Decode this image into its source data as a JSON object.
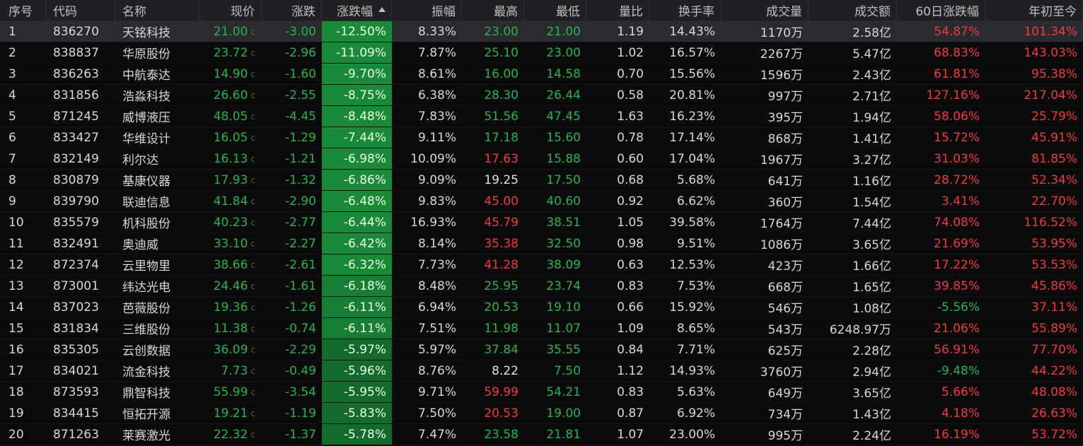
{
  "headers": {
    "seq": "序号",
    "code": "代码",
    "name": "名称",
    "price": "现价",
    "change": "涨跌",
    "pct": "涨跌幅",
    "amplitude": "振幅",
    "high": "最高",
    "low": "最低",
    "vol_ratio": "量比",
    "turnover": "换手率",
    "volume": "成交量",
    "amount": "成交额",
    "change_60d": "60日涨跌幅",
    "ytd": "年初至今"
  },
  "price_unit": "c",
  "colors": {
    "up": "#ef3b3b",
    "down": "#27b548",
    "pct_bg_strong": "#1b8a38",
    "pct_bg_mid": "#187e34",
    "pct_bg_weak": "#14692d"
  },
  "rows": [
    {
      "seq": "1",
      "code": "836270",
      "name": "天铭科技",
      "price": "21.00",
      "change": "-3.00",
      "pct": "-12.50%",
      "amplitude": "8.33%",
      "high": "23.00",
      "low": "21.00",
      "vol_ratio": "1.19",
      "turnover": "14.43%",
      "volume": "1170万",
      "amount": "2.58亿",
      "change_60d": "54.87%",
      "ytd": "101.34%",
      "high_color": "green",
      "low_color": "green",
      "d60_color": "red",
      "ytd_color": "red"
    },
    {
      "seq": "2",
      "code": "838837",
      "name": "华原股份",
      "price": "23.72",
      "change": "-2.96",
      "pct": "-11.09%",
      "amplitude": "7.87%",
      "high": "25.10",
      "low": "23.00",
      "vol_ratio": "1.02",
      "turnover": "16.57%",
      "volume": "2267万",
      "amount": "5.47亿",
      "change_60d": "68.83%",
      "ytd": "143.03%",
      "high_color": "green",
      "low_color": "green",
      "d60_color": "red",
      "ytd_color": "red"
    },
    {
      "seq": "3",
      "code": "836263",
      "name": "中航泰达",
      "price": "14.90",
      "change": "-1.60",
      "pct": "-9.70%",
      "amplitude": "8.61%",
      "high": "16.00",
      "low": "14.58",
      "vol_ratio": "0.70",
      "turnover": "15.56%",
      "volume": "1596万",
      "amount": "2.43亿",
      "change_60d": "61.81%",
      "ytd": "95.38%",
      "high_color": "green",
      "low_color": "green",
      "d60_color": "red",
      "ytd_color": "red"
    },
    {
      "seq": "4",
      "code": "831856",
      "name": "浩淼科技",
      "price": "26.60",
      "change": "-2.55",
      "pct": "-8.75%",
      "amplitude": "6.38%",
      "high": "28.30",
      "low": "26.44",
      "vol_ratio": "0.58",
      "turnover": "20.81%",
      "volume": "997万",
      "amount": "2.71亿",
      "change_60d": "127.16%",
      "ytd": "217.04%",
      "high_color": "green",
      "low_color": "green",
      "d60_color": "red",
      "ytd_color": "red"
    },
    {
      "seq": "5",
      "code": "871245",
      "name": "威博液压",
      "price": "48.05",
      "change": "-4.45",
      "pct": "-8.48%",
      "amplitude": "7.83%",
      "high": "51.56",
      "low": "47.45",
      "vol_ratio": "1.63",
      "turnover": "16.23%",
      "volume": "395万",
      "amount": "1.94亿",
      "change_60d": "58.06%",
      "ytd": "25.79%",
      "high_color": "green",
      "low_color": "green",
      "d60_color": "red",
      "ytd_color": "red"
    },
    {
      "seq": "6",
      "code": "833427",
      "name": "华维设计",
      "price": "16.05",
      "change": "-1.29",
      "pct": "-7.44%",
      "amplitude": "9.11%",
      "high": "17.18",
      "low": "15.60",
      "vol_ratio": "0.78",
      "turnover": "17.14%",
      "volume": "868万",
      "amount": "1.41亿",
      "change_60d": "15.72%",
      "ytd": "45.91%",
      "high_color": "green",
      "low_color": "green",
      "d60_color": "red",
      "ytd_color": "red"
    },
    {
      "seq": "7",
      "code": "832149",
      "name": "利尔达",
      "price": "16.13",
      "change": "-1.21",
      "pct": "-6.98%",
      "amplitude": "10.09%",
      "high": "17.63",
      "low": "15.88",
      "vol_ratio": "0.60",
      "turnover": "17.04%",
      "volume": "1967万",
      "amount": "3.27亿",
      "change_60d": "31.03%",
      "ytd": "81.85%",
      "high_color": "red",
      "low_color": "green",
      "d60_color": "red",
      "ytd_color": "red"
    },
    {
      "seq": "8",
      "code": "830879",
      "name": "基康仪器",
      "price": "17.93",
      "change": "-1.32",
      "pct": "-6.86%",
      "amplitude": "9.09%",
      "high": "19.25",
      "low": "17.50",
      "vol_ratio": "0.68",
      "turnover": "5.68%",
      "volume": "641万",
      "amount": "1.16亿",
      "change_60d": "28.72%",
      "ytd": "52.34%",
      "high_color": "white",
      "low_color": "green",
      "d60_color": "red",
      "ytd_color": "red"
    },
    {
      "seq": "9",
      "code": "839790",
      "name": "联迪信息",
      "price": "41.84",
      "change": "-2.90",
      "pct": "-6.48%",
      "amplitude": "9.83%",
      "high": "45.00",
      "low": "40.60",
      "vol_ratio": "0.92",
      "turnover": "6.62%",
      "volume": "360万",
      "amount": "1.54亿",
      "change_60d": "3.41%",
      "ytd": "22.70%",
      "high_color": "red",
      "low_color": "green",
      "d60_color": "red",
      "ytd_color": "red"
    },
    {
      "seq": "10",
      "code": "835579",
      "name": "机科股份",
      "price": "40.23",
      "change": "-2.77",
      "pct": "-6.44%",
      "amplitude": "16.93%",
      "high": "45.79",
      "low": "38.51",
      "vol_ratio": "1.05",
      "turnover": "39.58%",
      "volume": "1764万",
      "amount": "7.44亿",
      "change_60d": "74.08%",
      "ytd": "116.52%",
      "high_color": "red",
      "low_color": "green",
      "d60_color": "red",
      "ytd_color": "red"
    },
    {
      "seq": "11",
      "code": "832491",
      "name": "奥迪威",
      "price": "33.10",
      "change": "-2.27",
      "pct": "-6.42%",
      "amplitude": "8.14%",
      "high": "35.38",
      "low": "32.50",
      "vol_ratio": "0.98",
      "turnover": "9.51%",
      "volume": "1086万",
      "amount": "3.65亿",
      "change_60d": "21.69%",
      "ytd": "53.95%",
      "high_color": "red",
      "low_color": "green",
      "d60_color": "red",
      "ytd_color": "red"
    },
    {
      "seq": "12",
      "code": "872374",
      "name": "云里物里",
      "price": "38.66",
      "change": "-2.61",
      "pct": "-6.32%",
      "amplitude": "7.73%",
      "high": "41.28",
      "low": "38.09",
      "vol_ratio": "0.63",
      "turnover": "12.53%",
      "volume": "423万",
      "amount": "1.66亿",
      "change_60d": "17.22%",
      "ytd": "53.53%",
      "high_color": "red",
      "low_color": "green",
      "d60_color": "red",
      "ytd_color": "red"
    },
    {
      "seq": "13",
      "code": "873001",
      "name": "纬达光电",
      "price": "24.46",
      "change": "-1.61",
      "pct": "-6.18%",
      "amplitude": "8.48%",
      "high": "25.95",
      "low": "23.74",
      "vol_ratio": "0.83",
      "turnover": "7.53%",
      "volume": "668万",
      "amount": "1.65亿",
      "change_60d": "39.85%",
      "ytd": "45.86%",
      "high_color": "green",
      "low_color": "green",
      "d60_color": "red",
      "ytd_color": "red"
    },
    {
      "seq": "14",
      "code": "837023",
      "name": "芭薇股份",
      "price": "19.36",
      "change": "-1.26",
      "pct": "-6.11%",
      "amplitude": "6.94%",
      "high": "20.53",
      "low": "19.10",
      "vol_ratio": "0.66",
      "turnover": "15.92%",
      "volume": "546万",
      "amount": "1.08亿",
      "change_60d": "-5.56%",
      "ytd": "37.11%",
      "high_color": "green",
      "low_color": "green",
      "d60_color": "green",
      "ytd_color": "red"
    },
    {
      "seq": "15",
      "code": "831834",
      "name": "三维股份",
      "price": "11.38",
      "change": "-0.74",
      "pct": "-6.11%",
      "amplitude": "7.51%",
      "high": "11.98",
      "low": "11.07",
      "vol_ratio": "1.09",
      "turnover": "8.65%",
      "volume": "543万",
      "amount": "6248.97万",
      "change_60d": "21.06%",
      "ytd": "55.89%",
      "high_color": "green",
      "low_color": "green",
      "d60_color": "red",
      "ytd_color": "red"
    },
    {
      "seq": "16",
      "code": "835305",
      "name": "云创数据",
      "price": "36.09",
      "change": "-2.29",
      "pct": "-5.97%",
      "amplitude": "5.97%",
      "high": "37.84",
      "low": "35.55",
      "vol_ratio": "0.84",
      "turnover": "7.71%",
      "volume": "625万",
      "amount": "2.28亿",
      "change_60d": "56.91%",
      "ytd": "77.70%",
      "high_color": "green",
      "low_color": "green",
      "d60_color": "red",
      "ytd_color": "red"
    },
    {
      "seq": "17",
      "code": "834021",
      "name": "流金科技",
      "price": "7.73",
      "change": "-0.49",
      "pct": "-5.96%",
      "amplitude": "8.76%",
      "high": "8.22",
      "low": "7.50",
      "vol_ratio": "1.12",
      "turnover": "14.93%",
      "volume": "3760万",
      "amount": "2.94亿",
      "change_60d": "-9.48%",
      "ytd": "44.22%",
      "high_color": "white",
      "low_color": "green",
      "d60_color": "green",
      "ytd_color": "red"
    },
    {
      "seq": "18",
      "code": "873593",
      "name": "鼎智科技",
      "price": "55.99",
      "change": "-3.54",
      "pct": "-5.95%",
      "amplitude": "9.71%",
      "high": "59.99",
      "low": "54.21",
      "vol_ratio": "0.83",
      "turnover": "5.63%",
      "volume": "649万",
      "amount": "3.65亿",
      "change_60d": "5.66%",
      "ytd": "48.08%",
      "high_color": "red",
      "low_color": "green",
      "d60_color": "red",
      "ytd_color": "red"
    },
    {
      "seq": "19",
      "code": "834415",
      "name": "恒拓开源",
      "price": "19.21",
      "change": "-1.19",
      "pct": "-5.83%",
      "amplitude": "7.50%",
      "high": "20.53",
      "low": "19.00",
      "vol_ratio": "0.87",
      "turnover": "6.92%",
      "volume": "734万",
      "amount": "1.43亿",
      "change_60d": "4.18%",
      "ytd": "26.63%",
      "high_color": "red",
      "low_color": "green",
      "d60_color": "red",
      "ytd_color": "red"
    },
    {
      "seq": "20",
      "code": "871263",
      "name": "莱赛激光",
      "price": "22.32",
      "change": "-1.37",
      "pct": "-5.78%",
      "amplitude": "7.47%",
      "high": "23.58",
      "low": "21.81",
      "vol_ratio": "1.07",
      "turnover": "23.00%",
      "volume": "995万",
      "amount": "2.24亿",
      "change_60d": "16.19%",
      "ytd": "53.72%",
      "high_color": "green",
      "low_color": "green",
      "d60_color": "red",
      "ytd_color": "red"
    }
  ]
}
